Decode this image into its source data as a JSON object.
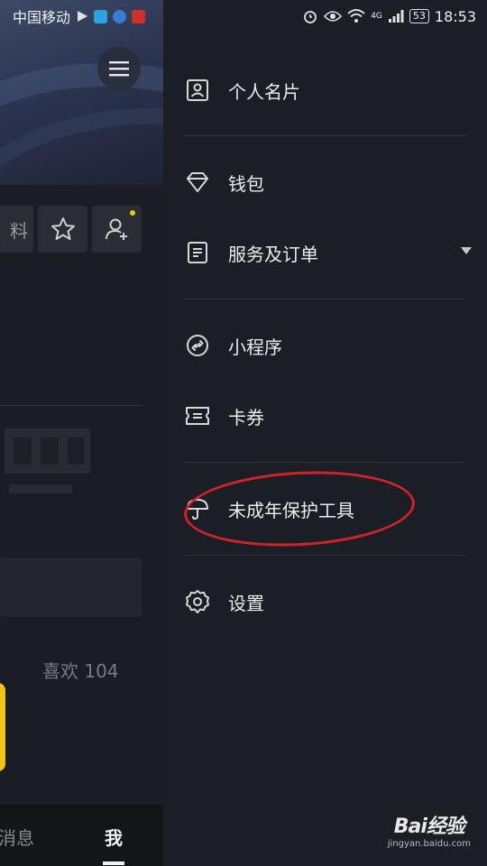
{
  "status_bar": {
    "carrier": "中国移动",
    "network_badge": "4G",
    "battery": "53",
    "time": "18:53"
  },
  "background": {
    "edit_button_partial": "料",
    "likes_label": "喜欢 104",
    "nav": {
      "messages": "消息",
      "me": "我"
    }
  },
  "drawer": {
    "items": [
      {
        "label": "个人名片",
        "icon": "contact-card-icon"
      },
      {
        "label": "钱包",
        "icon": "diamond-wallet-icon"
      },
      {
        "label": "服务及订单",
        "icon": "order-list-icon"
      },
      {
        "label": "小程序",
        "icon": "link-icon"
      },
      {
        "label": "卡券",
        "icon": "ticket-icon"
      },
      {
        "label": "未成年保护工具",
        "icon": "umbrella-icon"
      },
      {
        "label": "设置",
        "icon": "gear-icon"
      }
    ]
  },
  "colors": {
    "drawer_bg": "#1c1e26",
    "accent_yellow": "#f2c41a",
    "highlight_red": "#d0222a"
  },
  "watermark": {
    "brand": "Bai经验",
    "url": "jingyan.baidu.com"
  }
}
